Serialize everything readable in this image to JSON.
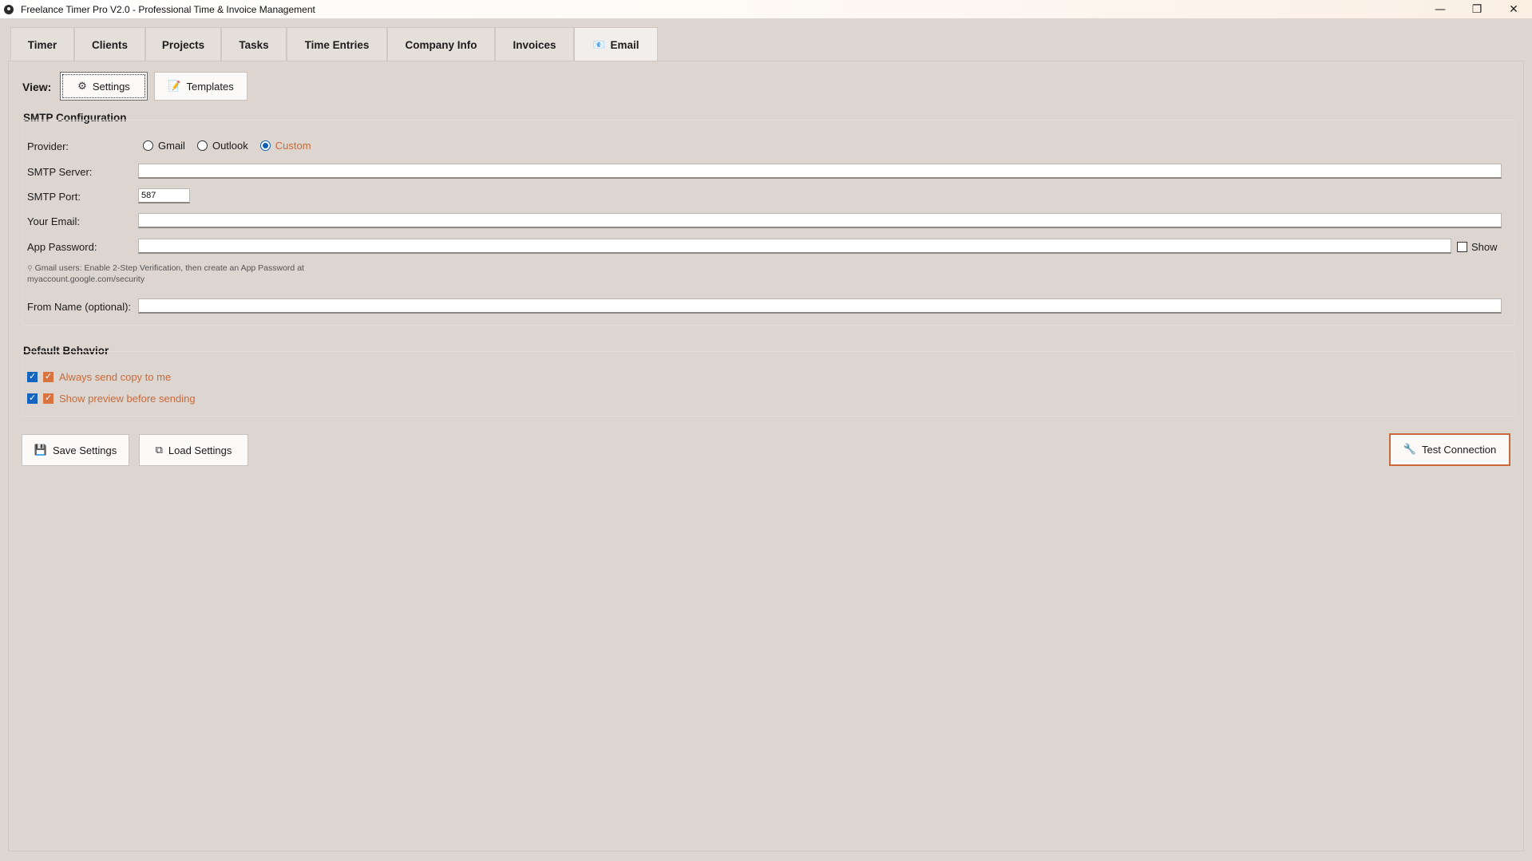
{
  "window": {
    "title": "Freelance Timer Pro V2.0 - Professional Time & Invoice Management",
    "controls": [
      "—",
      "❐",
      "✕"
    ]
  },
  "tabs": [
    {
      "label": "Timer"
    },
    {
      "label": "Clients"
    },
    {
      "label": "Projects"
    },
    {
      "label": "Tasks"
    },
    {
      "label": "Time Entries"
    },
    {
      "label": "Company Info"
    },
    {
      "label": "Invoices"
    },
    {
      "label": "Email",
      "icon": "email-icon",
      "active": true
    }
  ],
  "view": {
    "label": "View:",
    "settings_button": "Settings",
    "templates_button": "Templates"
  },
  "smtp": {
    "section_title": "SMTP Configuration",
    "provider_label": "Provider:",
    "providers": [
      {
        "label": "Gmail",
        "selected": false
      },
      {
        "label": "Outlook",
        "selected": false
      },
      {
        "label": "Custom",
        "selected": true
      }
    ],
    "server_label": "SMTP Server:",
    "server_value": "",
    "port_label": "SMTP Port:",
    "port_value": "587",
    "email_label": "Your Email:",
    "email_value": "",
    "password_label": "App Password:",
    "password_value": "",
    "show_label": "Show",
    "show_checked": false,
    "hint_line1": "Gmail users: Enable 2-Step Verification, then create an App Password at",
    "hint_line2": "myaccount.google.com/security",
    "from_name_label": "From Name (optional):",
    "from_name_value": ""
  },
  "defaults": {
    "section_title": "Default Behavior",
    "always_copy_label": "Always send copy to me",
    "always_copy_checked": true,
    "preview_label": "Show preview before sending",
    "preview_checked": true
  },
  "actions": {
    "save_label": "Save Settings",
    "load_label": "Load Settings",
    "test_label": "Test Connection"
  },
  "colors": {
    "accent": "#c86a3a",
    "radio_selected": "#0a5fb4",
    "checkbox_blue": "#1565c0",
    "checkbox_orange": "#d9733f",
    "background": "#dcd5d0"
  }
}
